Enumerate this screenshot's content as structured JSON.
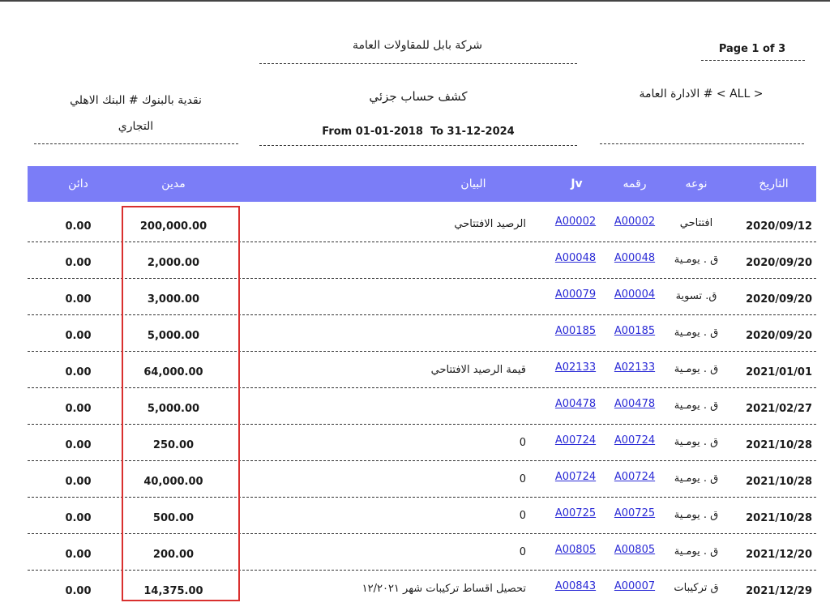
{
  "header": {
    "company": "شركة بابل للمقاولات العامة",
    "page": "Page 1 of 3",
    "account_line1": "نقدية بالبنوك # البنك الاهلي",
    "account_line2": "التجاري",
    "report_title": "كشف حساب جزئي",
    "date_range": "From 01-01-2018  To 31-12-2024",
    "branch": "< ALL > # الادارة العامة"
  },
  "columns": {
    "date": "التاريخ",
    "type": "نوعه",
    "number": "رقمه",
    "jv": "Jv",
    "description": "البيان",
    "debit": "مدين",
    "credit": "دائن"
  },
  "rows": [
    {
      "date": "2020/09/12",
      "type": "افتتاحي",
      "number": "A00002",
      "jv": "A00002",
      "description": "الرصيد الافتتاحي",
      "debit": "200,000.00",
      "credit": "0.00"
    },
    {
      "date": "2020/09/20",
      "type": "ق . يومـية",
      "number": "A00048",
      "jv": "A00048",
      "description": "",
      "debit": "2,000.00",
      "credit": "0.00"
    },
    {
      "date": "2020/09/20",
      "type": "ق. تسوية",
      "number": "A00004",
      "jv": "A00079",
      "description": "",
      "debit": "3,000.00",
      "credit": "0.00"
    },
    {
      "date": "2020/09/20",
      "type": "ق . يومـية",
      "number": "A00185",
      "jv": "A00185",
      "description": "",
      "debit": "5,000.00",
      "credit": "0.00"
    },
    {
      "date": "2021/01/01",
      "type": "ق . يومـية",
      "number": "A02133",
      "jv": "A02133",
      "description": "قيمة الرصيد الافتتاحي",
      "debit": "64,000.00",
      "credit": "0.00"
    },
    {
      "date": "2021/02/27",
      "type": "ق . يومـية",
      "number": "A00478",
      "jv": "A00478",
      "description": "",
      "debit": "5,000.00",
      "credit": "0.00"
    },
    {
      "date": "2021/10/28",
      "type": "ق . يومـية",
      "number": "A00724",
      "jv": "A00724",
      "description": "0",
      "debit": "250.00",
      "credit": "0.00"
    },
    {
      "date": "2021/10/28",
      "type": "ق . يومـية",
      "number": "A00724",
      "jv": "A00724",
      "description": "0",
      "debit": "40,000.00",
      "credit": "0.00"
    },
    {
      "date": "2021/10/28",
      "type": "ق . يومـية",
      "number": "A00725",
      "jv": "A00725",
      "description": "0",
      "debit": "500.00",
      "credit": "0.00"
    },
    {
      "date": "2021/12/20",
      "type": "ق . يومـية",
      "number": "A00805",
      "jv": "A00805",
      "description": "0",
      "debit": "200.00",
      "credit": "0.00"
    },
    {
      "date": "2021/12/29",
      "type": "ق تركيبات",
      "number": "A00007",
      "jv": "A00843",
      "description": "تحصيل اقساط تركيبات شهر ١٢/٢٠٢١",
      "debit": "14,375.00",
      "credit": "0.00"
    }
  ],
  "colors": {
    "header_bg": "#7b7df7",
    "link": "#2b2bd6",
    "highlight": "#d9302f"
  }
}
